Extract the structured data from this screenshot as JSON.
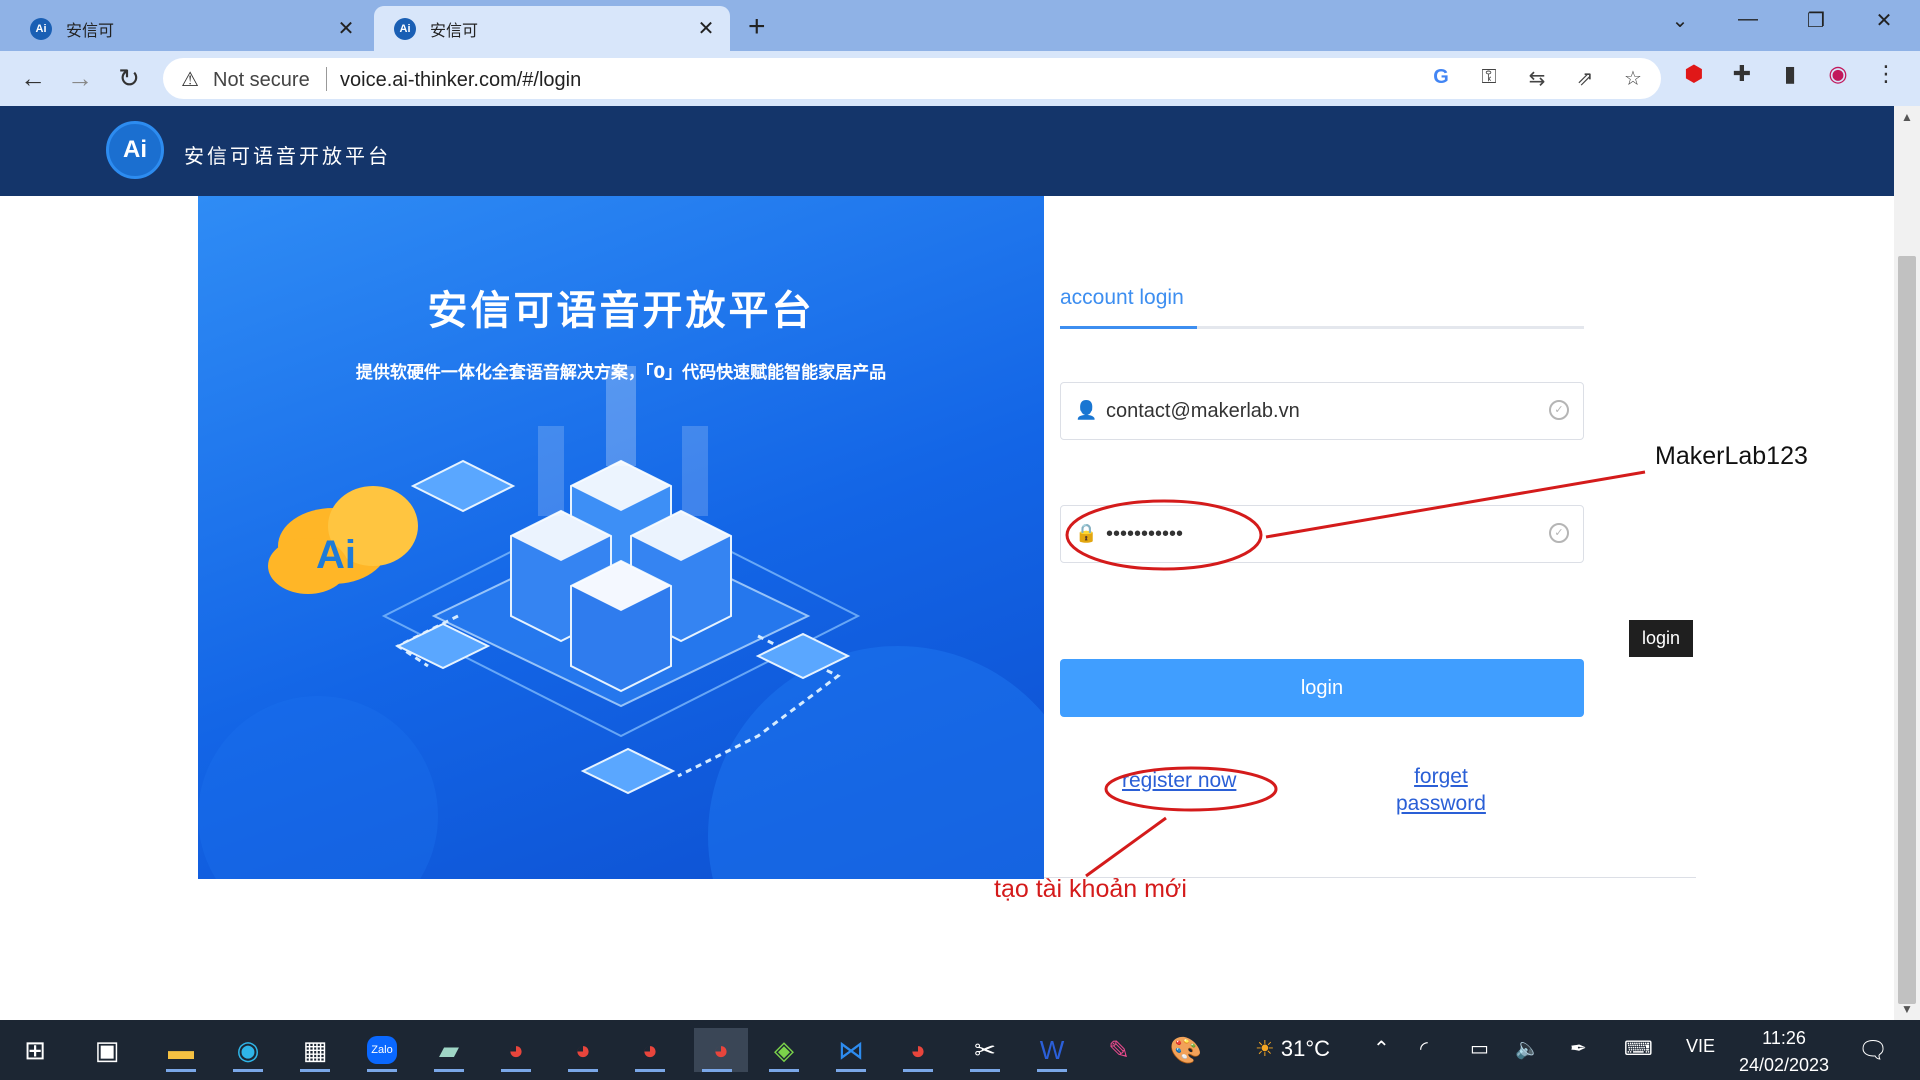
{
  "browser": {
    "tabs": [
      {
        "title": "安信可",
        "favicon": "ai-logo-icon",
        "active": false
      },
      {
        "title": "安信可",
        "favicon": "ai-logo-icon",
        "active": true
      }
    ],
    "security_label": "Not secure",
    "url": "voice.ai-thinker.com/#/login"
  },
  "site": {
    "logo_text": "Ai",
    "name": "安信可语音开放平台"
  },
  "banner": {
    "title": "安信可语音开放平台",
    "subtitle": "提供软硬件一体化全套语音解决方案，「0」代码快速赋能智能家居产品",
    "cloud_text": "Ai"
  },
  "login": {
    "tab_label": "account login",
    "username_value": "contact@makerlab.vn",
    "password_value": "•••••••••••",
    "button_label": "login",
    "register_label": "register now",
    "forget_line1": "forget",
    "forget_line2": "password",
    "tooltip": "login"
  },
  "annotations": {
    "password_hint": "MakerLab123",
    "register_hint": "tạo tài khoản mới",
    "color": "#d41b1b"
  },
  "taskbar": {
    "temperature": "31°C",
    "language": "VIE",
    "time": "11:26",
    "date": "24/02/2023",
    "zalo_label": "Zalo"
  },
  "colors": {
    "header_bg": "#14356a",
    "primary": "#409eff",
    "tab_accent": "#3d8ef0",
    "banner": "#1365e6"
  }
}
